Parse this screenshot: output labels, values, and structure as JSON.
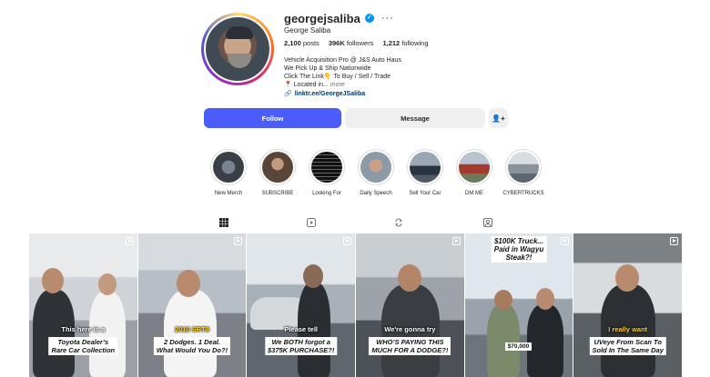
{
  "profile": {
    "username": "georgejsaliba",
    "full_name": "George Saliba",
    "verified": true,
    "more_icon": "more-horizontal-icon",
    "stats": {
      "posts": "2,100",
      "posts_label": "posts",
      "followers": "396K",
      "followers_label": "followers",
      "following": "1,212",
      "following_label": "following"
    },
    "bio": {
      "line1": "Vehicle Acquisition Pro @ J&S Auto Haus",
      "line2": "We Pick Up & Ship Nationwide",
      "line3": "Click The Link👇 To Buy / Sell / Trade",
      "line4": "📍 Located in...",
      "more": "more"
    },
    "link": "linktr.ee/GeorgeJSaliba"
  },
  "actions": {
    "follow": "Follow",
    "message": "Message",
    "add_user_icon": "add-user-icon"
  },
  "highlights": [
    {
      "label": "New Merch",
      "color": "#3a3f46"
    },
    {
      "label": "SUBSCRIBE",
      "color": "#5a4638"
    },
    {
      "label": "Looking For",
      "color": "#111111"
    },
    {
      "label": "Daily Speech",
      "color": "#8c9aa8"
    },
    {
      "label": "Sell Your Car",
      "color": "#4f5a66"
    },
    {
      "label": "DM ME",
      "color": "#6b7a5a"
    },
    {
      "label": "CYBERTRUCKS",
      "color": "#5c6670"
    }
  ],
  "tabs": [
    {
      "name": "posts",
      "icon": "grid-icon",
      "active": true
    },
    {
      "name": "reels",
      "icon": "reels-icon",
      "active": false
    },
    {
      "name": "reposts",
      "icon": "repost-icon",
      "active": false
    },
    {
      "name": "tagged",
      "icon": "tagged-icon",
      "active": false
    }
  ],
  "posts": [
    {
      "top_caption": "This here is a",
      "box_caption": "Toyota Dealer's\nRare Car Collection",
      "yellow": false
    },
    {
      "top_caption": "2010 SRT8",
      "box_caption": "2 Dodges. 1 Deal.\nWhat Would You Do?!",
      "yellow": true
    },
    {
      "top_caption": "Please tell",
      "box_caption": "We BOTH forgot a\n$375K PURCHASE?!",
      "yellow": false
    },
    {
      "top_caption": "We're gonna try",
      "box_caption": "WHO'S PAYING THIS\nMUCH FOR A DODGE?!",
      "yellow": false
    },
    {
      "top_box": "$100K Truck...\nPaid in Wagyu\nSteak?!",
      "price": "$70,000",
      "yellow": false
    },
    {
      "top_caption": "I really want",
      "box_caption": "UVeye From Scan To\nSold In The Same Day",
      "yellow": true
    }
  ]
}
